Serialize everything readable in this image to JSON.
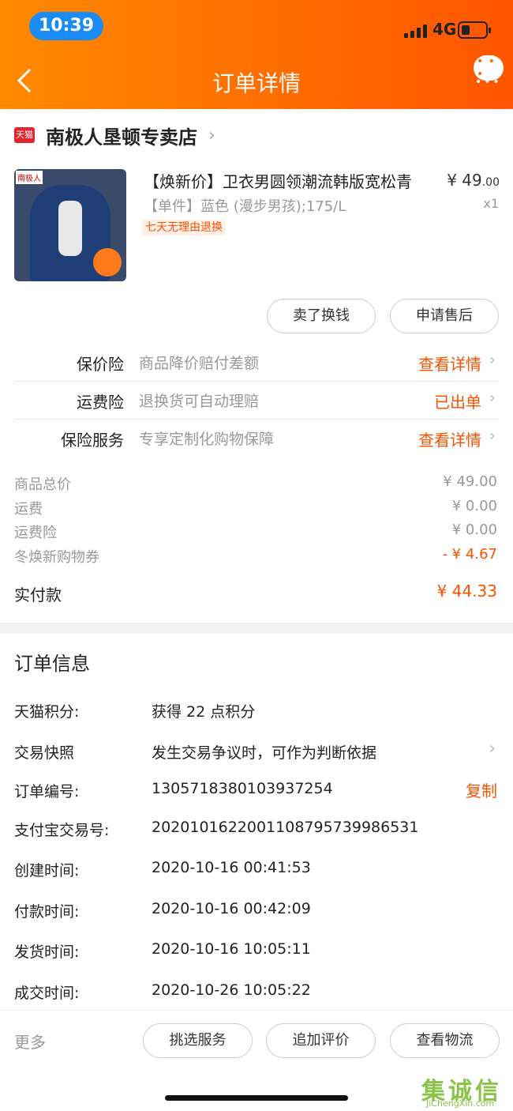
{
  "status_bar": {
    "time": "10:39",
    "network": "4G"
  },
  "nav": {
    "back_icon": "chevron-left-icon",
    "title": "订单详情",
    "more_icon": "chat-bubble-icon"
  },
  "shop": {
    "badge": "天猫",
    "name": "南极人垦顿专卖店",
    "chevron": "›"
  },
  "product": {
    "image_brand": "南极人",
    "title": "【焕新价】卫衣男圆领潮流韩版宽松青",
    "sku": "【单件】蓝色 (漫步男孩);175/L",
    "tag": "七天无理由退换",
    "price_currency": "¥",
    "price_int": "49",
    "price_dec": ".00",
    "qty": "x1"
  },
  "actions": {
    "sell": "卖了换钱",
    "after_sale": "申请售后"
  },
  "insurance": [
    {
      "label": "保价险",
      "desc": "商品降价赔付差额",
      "link": "查看详情"
    },
    {
      "label": "运费险",
      "desc": "退换货可自动理赔",
      "link": "已出单"
    },
    {
      "label": "保险服务",
      "desc": "专享定制化购物保障",
      "link": "查看详情"
    }
  ],
  "summary": [
    {
      "label": "商品总价",
      "value": "¥ 49.00"
    },
    {
      "label": "运费",
      "value": "¥ 0.00"
    },
    {
      "label": "运费险",
      "value": "¥ 0.00"
    },
    {
      "label": "冬焕新购物券",
      "value": "- ¥ 4.67"
    }
  ],
  "paid": {
    "label": "实付款",
    "value": "¥ 44.33"
  },
  "order_info": {
    "title": "订单信息",
    "rows": [
      {
        "label": "天猫积分:",
        "value": "获得 22 点积分"
      },
      {
        "label": "交易快照",
        "value": "发生交易争议时，可作为判断依据"
      },
      {
        "label": "订单编号:",
        "value": "1305718380103937254"
      },
      {
        "label": "支付宝交易号:",
        "value": "2020101622001108795739986531"
      },
      {
        "label": "创建时间:",
        "value": "2020-10-16 00:41:53"
      },
      {
        "label": "付款时间:",
        "value": "2020-10-16 00:42:09"
      },
      {
        "label": "发货时间:",
        "value": "2020-10-16 10:05:11"
      },
      {
        "label": "成交时间:",
        "value": "2020-10-26 10:05:22"
      }
    ],
    "copy": "复制"
  },
  "bottom": {
    "more": "更多",
    "buttons": [
      "挑选服务",
      "追加评价",
      "查看物流"
    ]
  },
  "watermark": {
    "text": "集诚信",
    "url": "JiChengXin.com"
  },
  "colors": {
    "accent": "#ff5000",
    "header_start": "#ff8a00",
    "header_end": "#ff5500",
    "time_pill": "#1b8cf5"
  }
}
